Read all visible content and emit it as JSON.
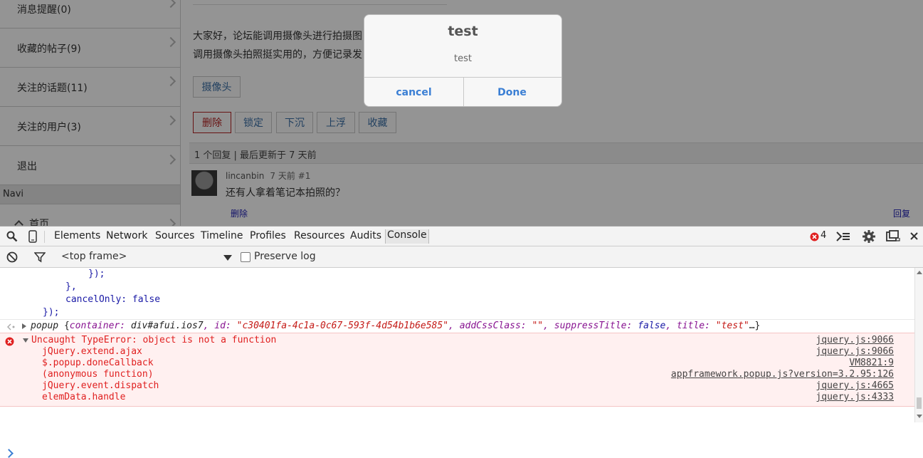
{
  "sidebar": {
    "items": [
      {
        "label": "消息提醒(0)"
      },
      {
        "label": "收藏的帖子(9)"
      },
      {
        "label": "关注的话题(11)"
      },
      {
        "label": "关注的用户(3)"
      },
      {
        "label": "退出"
      }
    ],
    "navi_header": "Navi",
    "home_label": "首页"
  },
  "post": {
    "line1": "大家好，论坛能调用摄像头进行拍摄图",
    "line2": "调用摄像头拍照挺实用的，方便记录发",
    "camera_button": "摄像头",
    "actions": [
      "删除",
      "锁定",
      "下沉",
      "上浮",
      "收藏"
    ],
    "reply_summary": "1 个回复 | 最后更新于 7 天前",
    "reply": {
      "user": "lincanbin",
      "time": "7 天前 #1",
      "text": "还有人拿着笔记本拍照的？",
      "delete_link": "删除",
      "reply_link": "回复"
    }
  },
  "dialog": {
    "title": "test",
    "message": "test",
    "cancel_label": "cancel",
    "done_label": "Done"
  },
  "devtools": {
    "tabs": [
      "Elements",
      "Network",
      "Sources",
      "Timeline",
      "Profiles",
      "Resources",
      "Audits",
      "Console"
    ],
    "active_tab": "Console",
    "error_count": "4",
    "frame_selector": "<top frame>",
    "preserve_log_label": "Preserve log",
    "console": {
      "line1": "});",
      "line2": "},",
      "line3_key": "cancelOnly:",
      "line3_val": " false",
      "line4": "});",
      "log_prefix": "popup ",
      "log_obj_open": "{",
      "log_container_key": "container:",
      "log_container_val": " div#afui.ios7",
      "log_id_key": ", id:",
      "log_id_val": " \"c30401fa-4c1a-0c67-593f-4d54b1b6e585\"",
      "log_addcss_key": ", addCssClass:",
      "log_addcss_val": " \"\"",
      "log_suppress_key": ", suppressTitle:",
      "log_suppress_val": " false",
      "log_title_key": ", title:",
      "log_title_val": " \"test\"",
      "log_obj_close": "…}",
      "error_message": "Uncaught TypeError: object is not a function",
      "stack": [
        {
          "fn": "jQuery.extend.ajax",
          "src": "jquery.js:9066"
        },
        {
          "fn": "$.popup.doneCallback",
          "src": "VM8821:9"
        },
        {
          "fn": "(anonymous function)",
          "src": "appframework.popup.js?version=3.2.95:126"
        },
        {
          "fn": "jQuery.event.dispatch",
          "src": "jquery.js:4665"
        },
        {
          "fn": "elemData.handle",
          "src": "jquery.js:4333"
        }
      ],
      "error_src": "jquery.js:9066"
    }
  },
  "colors": {
    "overlay": "#000000",
    "dialog_accent": "#3b7fd4",
    "error_red": "#e02020",
    "link_blue": "#3a6ea5"
  }
}
